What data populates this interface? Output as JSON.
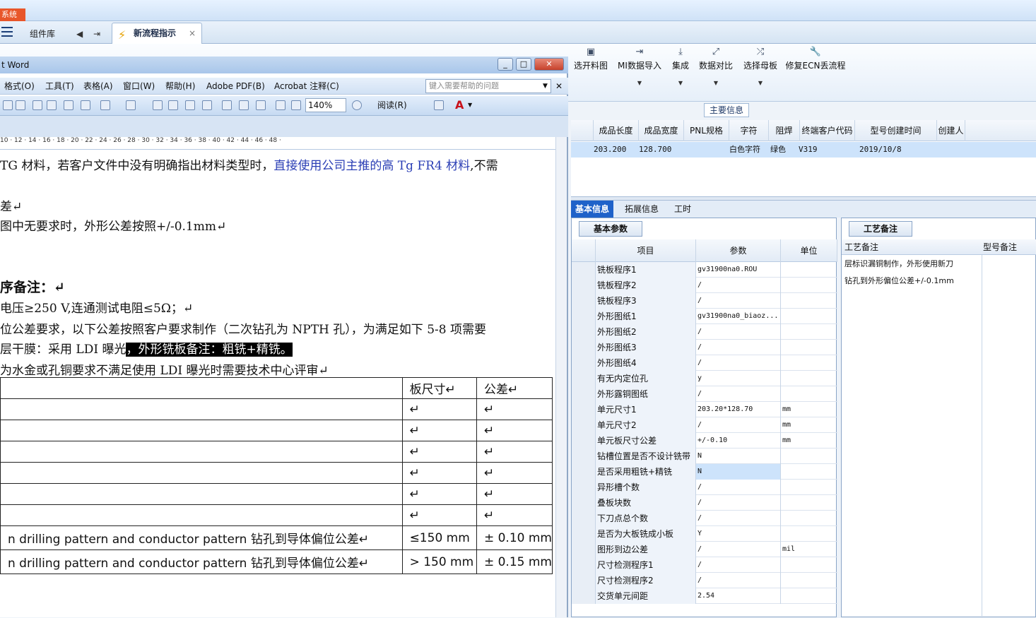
{
  "top": {
    "red_tab": "系统"
  },
  "tabs": {
    "component_lib": "组件库",
    "flow_tab": "新流程指示",
    "close": "×"
  },
  "ribbon": {
    "buttons": [
      {
        "label": "选开料图",
        "icon": "image-icon"
      },
      {
        "label": "MI数据导入",
        "icon": "import-icon"
      },
      {
        "label": "集成",
        "icon": "download-icon"
      },
      {
        "label": "数据对比",
        "icon": "compare-icon"
      },
      {
        "label": "选择母板",
        "icon": "shuffle-icon"
      },
      {
        "label": "修复ECN丢流程",
        "icon": "wrench-icon"
      }
    ]
  },
  "main_info": {
    "tab": "主要信息",
    "headers": [
      "成品长度",
      "成品宽度",
      "PNL规格",
      "字符",
      "阻焊",
      "终端客户代码",
      "型号创建时间",
      "创建人"
    ],
    "row": {
      "length": "203.200",
      "width": "128.700",
      "pnl": "",
      "char": "白色字符",
      "mask": "绿色",
      "customer": "V319",
      "created": "2019/10/8",
      "creator": ""
    }
  },
  "bottom_tabs": [
    "基本信息",
    "拓展信息",
    "工时"
  ],
  "basic_params": {
    "tab": "基本参数",
    "headers": {
      "item": "项目",
      "param": "参数",
      "unit": "单位"
    },
    "rows": [
      {
        "item": "铣板程序1",
        "param": "gv31900na0.ROU",
        "unit": ""
      },
      {
        "item": "铣板程序2",
        "param": "/",
        "unit": ""
      },
      {
        "item": "铣板程序3",
        "param": "/",
        "unit": ""
      },
      {
        "item": "外形图纸1",
        "param": "gv31900na0_biaoz...",
        "unit": ""
      },
      {
        "item": "外形图纸2",
        "param": "/",
        "unit": ""
      },
      {
        "item": "外形图纸3",
        "param": "/",
        "unit": ""
      },
      {
        "item": "外形图纸4",
        "param": "/",
        "unit": ""
      },
      {
        "item": "有无内定位孔",
        "param": "y",
        "unit": ""
      },
      {
        "item": "外形露铜图纸",
        "param": "/",
        "unit": ""
      },
      {
        "item": "单元尺寸1",
        "param": "203.20*128.70",
        "unit": "mm"
      },
      {
        "item": "单元尺寸2",
        "param": "/",
        "unit": "mm"
      },
      {
        "item": "单元板尺寸公差",
        "param": "+/-0.10",
        "unit": "mm"
      },
      {
        "item": "钻槽位置是否不设计铣带",
        "param": "N",
        "unit": ""
      },
      {
        "item": "是否采用粗铣+精铣",
        "param": "N",
        "unit": ""
      },
      {
        "item": "异形槽个数",
        "param": "/",
        "unit": ""
      },
      {
        "item": "叠板块数",
        "param": "/",
        "unit": ""
      },
      {
        "item": "下刀点总个数",
        "param": "/",
        "unit": ""
      },
      {
        "item": "是否为大板铣成小板",
        "param": "Y",
        "unit": ""
      },
      {
        "item": "图形到边公差",
        "param": "/",
        "unit": "mil"
      },
      {
        "item": "尺寸检测程序1",
        "param": "/",
        "unit": ""
      },
      {
        "item": "尺寸检测程序2",
        "param": "/",
        "unit": ""
      },
      {
        "item": "交货单元间距",
        "param": "2.54",
        "unit": ""
      }
    ]
  },
  "process_notes": {
    "tab": "工艺备注",
    "col1": "工艺备注",
    "col2": "型号备注",
    "lines": [
      "层标识漏铜制作，外形使用新刀",
      "钻孔到外形偏位公差+/-0.1mm"
    ]
  },
  "word": {
    "title": "t Word",
    "menu": [
      "格式(O)",
      "工具(T)",
      "表格(A)",
      "窗口(W)",
      "帮助(H)",
      "Adobe PDF(B)",
      "Acrobat 注释(C)"
    ],
    "help_placeholder": "键入需要帮助的问题",
    "zoom": "140%",
    "read": "阅读(R)",
    "ruler": "10 · 12 · 14 · 16 · 18 · 20 · 22 · 24 · 26 · 28 · 30 · 32 · 34 · 36 · 38 · 40 · 42 · 44 · 46 · 48 ·",
    "lines": {
      "l1a": "TG 材料，若客户文件中没有明确指出材料类型时，",
      "l1b": "直接使用公司主推的高 Tg FR4 材料",
      "l1c": ",不需",
      "l2": "差↵",
      "l3": "图中无要求时，外形公差按照+/-0.1mm↵",
      "l4": "序备注：↵",
      "l5": "电压≥250 V,连通测试电阻≤5Ω；↵",
      "l6": "位公差要求，以下公差按照客户要求制作（二次钻孔为 NPTH 孔），为满足如下 5-8 项需要",
      "l7a": "层干膜：采用 LDI 曝光",
      "l7b": "，外形铣板备注：粗铣+精铣。",
      "l8": "为水金或孔铜要求不满足使用 LDI 曝光时需要技术中心评审↵"
    },
    "table": {
      "header": [
        "",
        "板尺寸↵",
        "公差↵"
      ],
      "rows": [
        [
          "",
          "↵",
          "↵"
        ],
        [
          "",
          "↵",
          "↵"
        ],
        [
          "",
          "↵",
          "↵"
        ],
        [
          "",
          "↵",
          "↵"
        ],
        [
          "",
          "↵",
          "↵"
        ],
        [
          "",
          "↵",
          "↵"
        ],
        [
          "n drilling pattern and conductor pattern 钻孔到导体偏位公差↵",
          "≤150 mm",
          "± 0.10 mm"
        ],
        [
          "n drilling pattern and conductor pattern 钻孔到导体偏位公差↵",
          "> 150 mm",
          "± 0.15 mm"
        ]
      ]
    }
  }
}
